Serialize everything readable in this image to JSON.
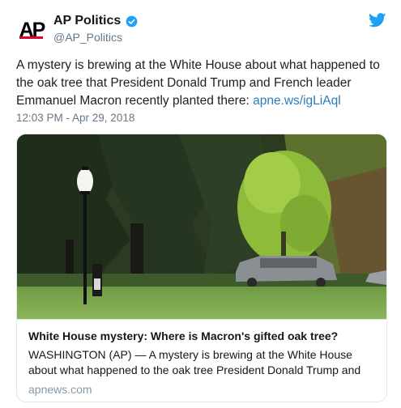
{
  "account": {
    "logo_text": "AP",
    "display_name": "AP Politics",
    "handle": "@AP_Politics",
    "verified": true
  },
  "tweet": {
    "text": "A mystery is brewing at the White House about what happened to the oak tree that President Donald Trump and French leader Emmanuel Macron recently planted there: ",
    "link": "apne.ws/igLiAql",
    "timestamp": "12:03 PM - Apr 29, 2018"
  },
  "card": {
    "title": "White House mystery: Where is Macron's gifted oak tree?",
    "description": "WASHINGTON (AP) — A mystery is brewing at the White House about what happened to the oak tree President Donald Trump and",
    "domain": "apnews.com"
  },
  "icons": {
    "verified": "verified-badge-icon",
    "twitter": "twitter-bird-icon"
  },
  "colors": {
    "link": "#2b7bb9",
    "verified": "#1da1f2",
    "ap_red": "#e4002b",
    "meta_gray": "#657786"
  }
}
